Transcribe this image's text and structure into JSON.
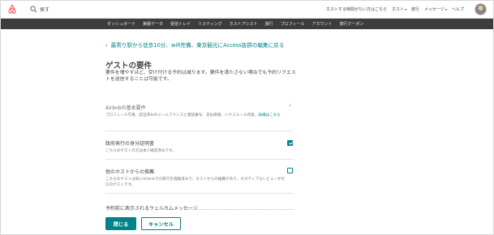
{
  "header": {
    "search_placeholder": "探す",
    "nav": {
      "host_guest_link": "ホストする時間がない方はこちら",
      "host": "ホスト",
      "trips": "旅行",
      "messages": "メッセージ",
      "help": "ヘルプ"
    }
  },
  "subnav": {
    "items": [
      "ダッシュボード",
      "実績データ",
      "受信トレイ",
      "リスティング",
      "ホストアシスト",
      "旅行",
      "プロフィール",
      "アカウント",
      "旅行クーポン"
    ]
  },
  "main": {
    "back_link": "最寄り駅から徒歩10分、wifi完備、東京観光にAccess抜群の編集に戻る",
    "title": "ゲストの要件",
    "description": "要件を増やすほど、受け付ける予約は減ります。要件を満たさない場合でも予約リクエストを送信することは可能です。",
    "requirements": [
      {
        "title": "Airbnbの基本要件",
        "text": "プロフィール写真、認証済みのメールアドレスと電話番号、支払情報、ハウスルール同意。",
        "more": "詳細はこちら",
        "checked": true
      },
      {
        "title": "政府発行の身分証明書",
        "text": "こちらのゲストの方は本人確認済みです。",
        "checked": true
      },
      {
        "title": "他のホストからの推薦",
        "text": "こちらのゲストは既にAirbnbでの旅行を経験済みで、ホストからの推薦があり、ネガティブなレビューがゼロのゲストです。",
        "checked": false
      }
    ],
    "welcome_label": "予約前に表示されるウェルカムメッセージ",
    "close_button": "閉じる",
    "cancel_button": "キャンセル"
  },
  "colors": {
    "accent": "#008489",
    "subnav_bg": "#3c3c3c",
    "logo": "#ff5a5f"
  }
}
